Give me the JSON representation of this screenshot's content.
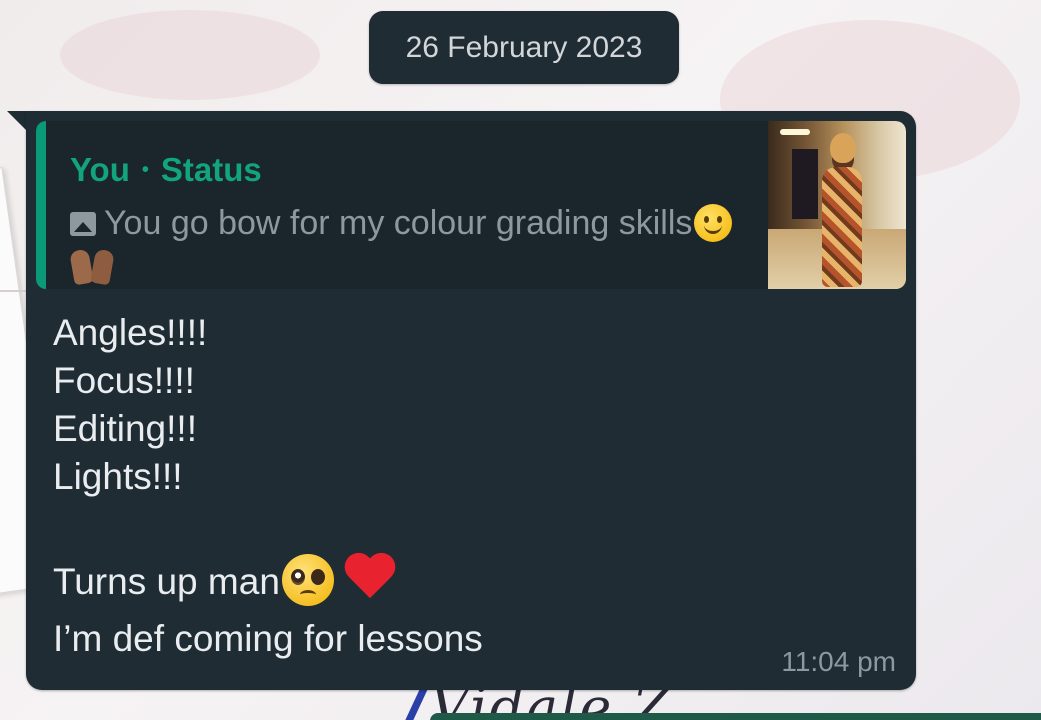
{
  "date_chip": "26 February 2023",
  "message": {
    "reply": {
      "author": "You",
      "separator": "•",
      "source": "Status",
      "icon": "photo-icon",
      "text": "You go bow for my colour grading skills",
      "emojis": [
        "slightly-smiling-face",
        "palms-up-together"
      ]
    },
    "lines": [
      "Angles!!!!",
      "Focus!!!!",
      "Editing!!!",
      "Lights!!!",
      "",
      "Turns up man",
      "I’m def coming for lessons"
    ],
    "emojis_after_line_6": [
      "pleading-face",
      "red-heart"
    ],
    "time": "11:04 pm"
  },
  "colors": {
    "bubble": "#1f2c34",
    "quote_accent": "#0a9a78",
    "quote_title": "#12a37f",
    "text_primary": "#e9edef",
    "text_secondary": "#8d989f"
  },
  "wallpaper": {
    "partial_text": "Vidale Z"
  }
}
